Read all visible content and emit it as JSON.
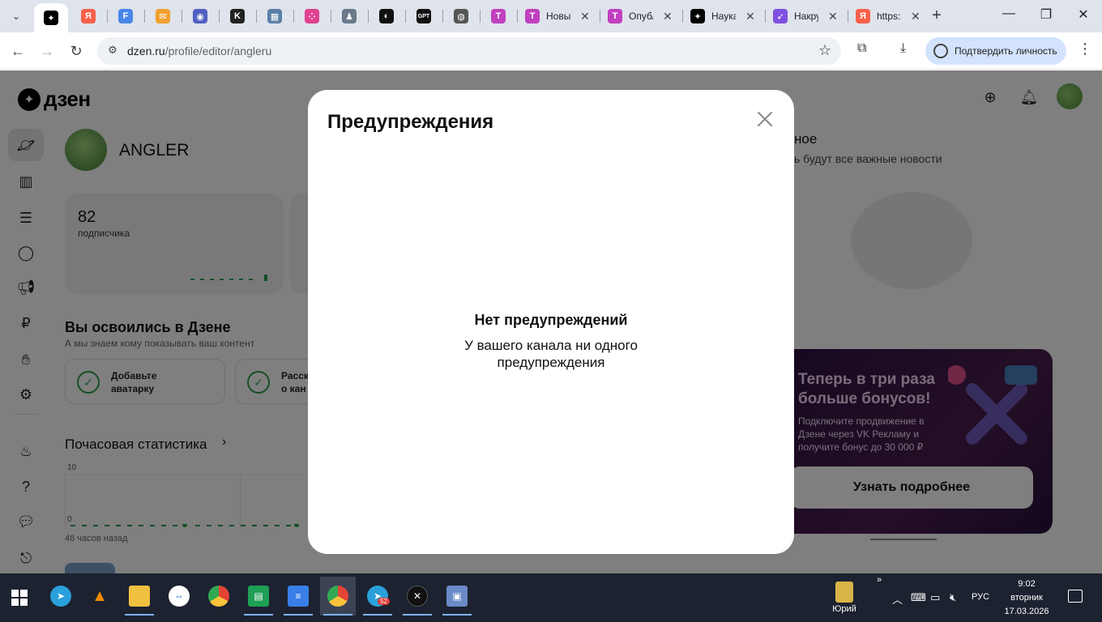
{
  "browser": {
    "tabs": [
      {
        "icon": "dzen-icon",
        "title": "",
        "active": true,
        "color": "#000000",
        "glyph": "✦"
      },
      {
        "icon": "yandex-icon",
        "title": "",
        "color": "#f8604a",
        "glyph": "Я"
      },
      {
        "icon": "f-icon",
        "title": "",
        "color": "#4a86e8",
        "glyph": "F"
      },
      {
        "icon": "mail-icon",
        "title": "",
        "color": "#f0a030",
        "glyph": "✉"
      },
      {
        "icon": "eye-icon",
        "title": "",
        "color": "#5060c0",
        "glyph": "◉"
      },
      {
        "icon": "k-icon",
        "title": "",
        "color": "#222222",
        "glyph": "K"
      },
      {
        "icon": "bus-icon",
        "title": "",
        "color": "#5a80a8",
        "glyph": "▦"
      },
      {
        "icon": "dots-icon",
        "title": "",
        "color": "#e04090",
        "glyph": "⁘"
      },
      {
        "icon": "figure-icon",
        "title": "",
        "color": "#6a7a8a",
        "glyph": "♟"
      },
      {
        "icon": "circle-icon",
        "title": "",
        "color": "#111111",
        "glyph": "◐"
      },
      {
        "icon": "gpt-icon",
        "title": "",
        "color": "#111111",
        "glyph": "GPT"
      },
      {
        "icon": "globe-icon",
        "title": "",
        "color": "#555555",
        "glyph": "◍"
      },
      {
        "icon": "t-icon",
        "title": "",
        "color": "#c040c0",
        "glyph": "T"
      },
      {
        "icon": "t-icon",
        "title": "Новы",
        "color": "#c040c0",
        "glyph": "T",
        "closable": true
      },
      {
        "icon": "t-icon",
        "title": "Опубл",
        "color": "#c040c0",
        "glyph": "T",
        "closable": true
      },
      {
        "icon": "dzen-icon",
        "title": "Наука",
        "color": "#000000",
        "glyph": "✦",
        "closable": true
      },
      {
        "icon": "rocket-icon",
        "title": "Накру",
        "color": "#8050e0",
        "glyph": "➶",
        "closable": true
      },
      {
        "icon": "yandex-icon",
        "title": "https:",
        "color": "#f8604a",
        "glyph": "Я",
        "closable": true
      }
    ],
    "url_domain": "dzen.ru",
    "url_path": "/profile/editor/angleru",
    "verify_label": "Подтвердить личность"
  },
  "page": {
    "logo_text": "дзен",
    "profile_name": "ANGLER",
    "subscribers_count": "82",
    "subscribers_label": "подписчика",
    "onboarding_title": "Вы освоились в Дзене",
    "onboarding_sub": "А мы знаем кому показывать ваш контент",
    "tasks": [
      "Добавьте аватарку",
      "Расск о кан"
    ],
    "hourly_title": "Почасовая статистика",
    "chart_data": {
      "type": "line",
      "ylim": [
        0,
        10
      ],
      "y_ticks": [
        "10",
        "0"
      ],
      "x_label": "48 часов назад"
    },
    "right_title_partial": "ное",
    "right_sub_partial": "ь будут все важные новости",
    "promo_title": "Теперь в три раза больше бонусов!",
    "promo_text": "Подключите продвижение в Дзене через VK Рекламу и получите бонус до 30 000 ₽",
    "promo_button": "Узнать подробнее"
  },
  "modal": {
    "title": "Предупреждения",
    "empty_title": "Нет предупреждений",
    "empty_text": "У вашего канала ни одного предупреждения"
  },
  "taskbar": {
    "telegram_badge": "52",
    "user_name": "Юрий",
    "lang": "РУС",
    "time": "9:02",
    "day": "вторник",
    "date": "17.03.2026"
  },
  "colors": {
    "accent_green": "#2aa14a",
    "overlay": "rgba(0,0,0,0.5)",
    "verify_bg": "#d3e3fd"
  }
}
